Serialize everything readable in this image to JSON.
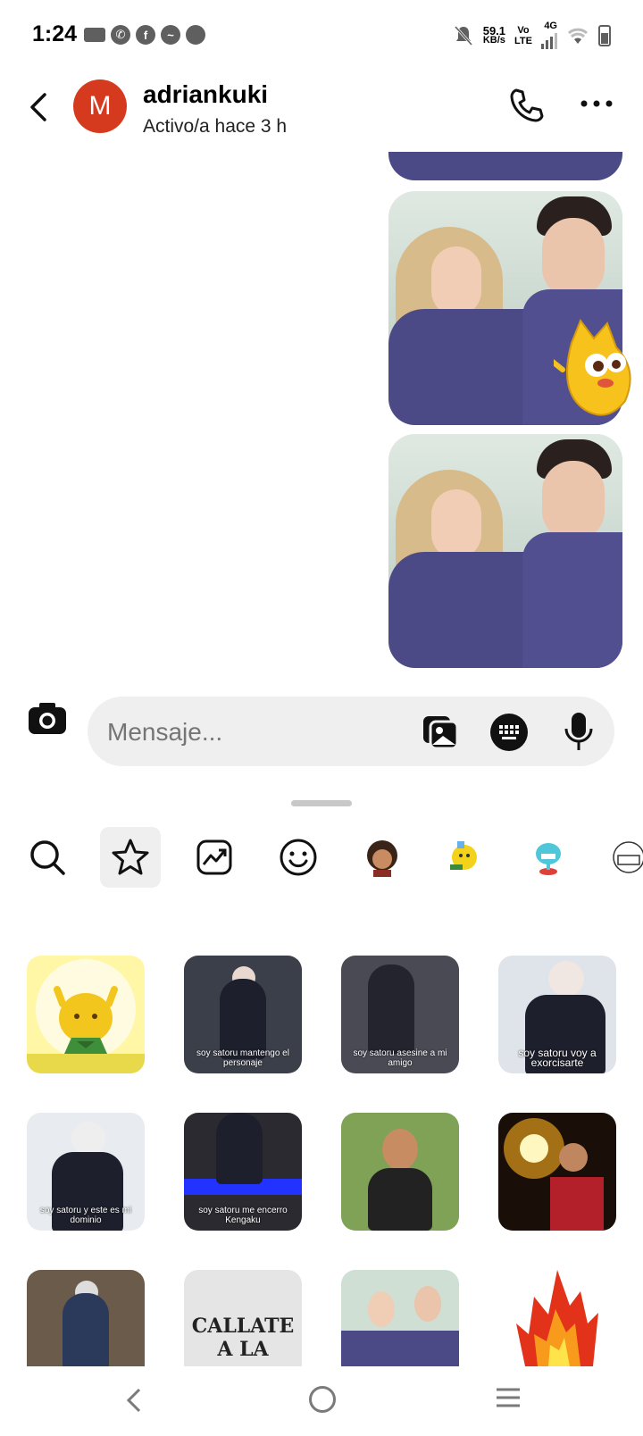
{
  "status_bar": {
    "time": "1:24",
    "net_speed_value": "59.1",
    "net_speed_unit": "KB/s",
    "vo": "Vo",
    "lte": "LTE",
    "network": "4G",
    "left_icons": [
      "video-icon",
      "whatsapp-icon",
      "facebook-icon",
      "messenger-icon",
      "chat-icon"
    ]
  },
  "header": {
    "avatar_letter": "M",
    "contact_name": "adriankuki",
    "contact_status": "Activo/a hace 3 h"
  },
  "composer": {
    "placeholder": "Mensaje..."
  },
  "sticker_tabs": [
    {
      "name": "search-icon"
    },
    {
      "name": "star-icon",
      "active": true
    },
    {
      "name": "trending-icon"
    },
    {
      "name": "emoji-icon"
    },
    {
      "name": "avatar-sticker-icon"
    },
    {
      "name": "yellow-sticker-icon"
    },
    {
      "name": "blue-sticker-icon"
    },
    {
      "name": "sketch-sticker-icon"
    }
  ],
  "stickers": [
    {
      "caption": ""
    },
    {
      "caption": "soy satoru mantengo el personaje"
    },
    {
      "caption": "soy satoru asesine a mi amigo"
    },
    {
      "caption": "soy satoru voy a exorcisarte"
    },
    {
      "caption": "soy satoru y este es mi dominio"
    },
    {
      "caption": "soy satoru me encerro Kengaku"
    },
    {
      "caption": ""
    },
    {
      "caption": ""
    },
    {
      "caption": ""
    },
    {
      "caption": "CALLATE A LA"
    },
    {
      "caption": ""
    },
    {
      "caption": ""
    }
  ],
  "colors": {
    "avatar_bg": "#d53a1f",
    "composer_bg": "#efefef",
    "active_tab_bg": "#efefef"
  }
}
